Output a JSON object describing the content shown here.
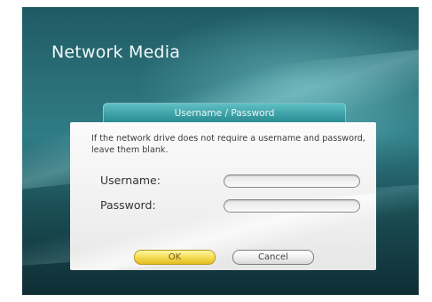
{
  "app": {
    "title": "Network Media"
  },
  "dialog": {
    "tab_label": "Username / Password",
    "message": "If the network drive does not require a username and password, leave them blank.",
    "fields": {
      "username_label": "Username:",
      "username_value": "",
      "password_label": "Password:",
      "password_value": ""
    },
    "buttons": {
      "ok_label": "OK",
      "cancel_label": "Cancel"
    }
  },
  "colors": {
    "background_teal": "#2f7c86",
    "tab_teal": "#3a9ea4",
    "ok_yellow": "#f4d94e",
    "dialog_bg": "#f1f1f1"
  }
}
